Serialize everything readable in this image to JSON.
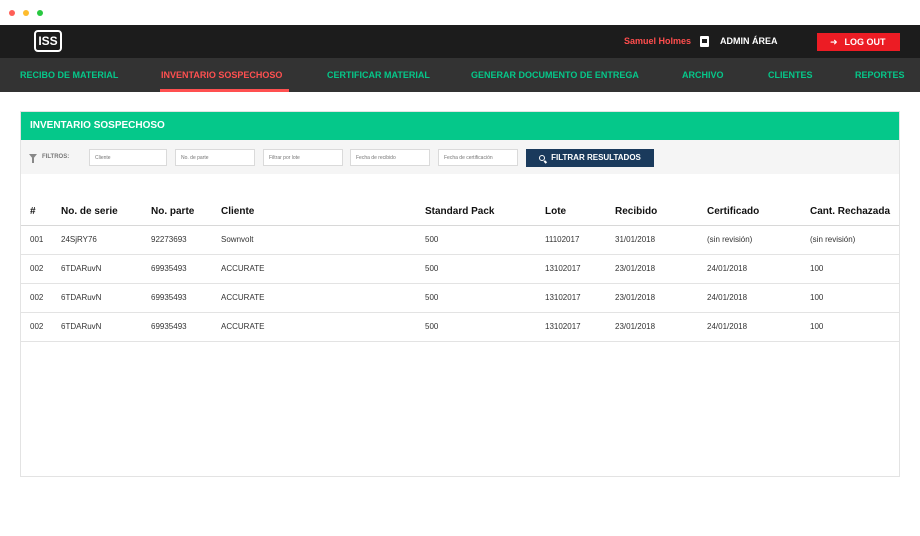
{
  "header": {
    "logo_text": "ISS",
    "user_name": "Samuel Holmes",
    "admin_label": "ADMIN ÁREA",
    "logout_label": "LOG OUT"
  },
  "nav": {
    "items": [
      {
        "label": "RECIBO DE MATERIAL",
        "active": false
      },
      {
        "label": "INVENTARIO SOSPECHOSO",
        "active": true
      },
      {
        "label": "CERTIFICAR MATERIAL",
        "active": false
      },
      {
        "label": "GENERAR  DOCUMENTO DE ENTREGA",
        "active": false
      },
      {
        "label": "ARCHIVO",
        "active": false
      },
      {
        "label": "CLIENTES",
        "active": false
      },
      {
        "label": "REPORTES",
        "active": false
      }
    ]
  },
  "panel": {
    "title": "INVENTARIO SOSPECHOSO",
    "filters": {
      "label": "FILTROS:",
      "cliente_placeholder": "Cliente",
      "parte_placeholder": "No. de parte",
      "lote_placeholder": "Filtrar por lote",
      "recibido_placeholder": "Fecha de recibido",
      "certificacion_placeholder": "Fecha de certificación",
      "button_label": "FILTRAR RESULTADOS"
    },
    "table": {
      "headers": [
        "#",
        "No. de serie",
        "No. parte",
        "Cliente",
        "Standard Pack",
        "Lote",
        "Recibido",
        "Certificado",
        "Cant. Rechazada"
      ],
      "rows": [
        [
          "001",
          "24SjRY76",
          "92273693",
          "Sownvolt",
          "500",
          "11102017",
          "31/01/2018",
          "(sin revisión)",
          "(sin revisión)"
        ],
        [
          "002",
          "6TDARuvN",
          "69935493",
          "ACCURATE",
          "500",
          "13102017",
          "23/01/2018",
          "24/01/2018",
          "100"
        ],
        [
          "002",
          "6TDARuvN",
          "69935493",
          "ACCURATE",
          "500",
          "13102017",
          "23/01/2018",
          "24/01/2018",
          "100"
        ],
        [
          "002",
          "6TDARuvN",
          "69935493",
          "ACCURATE",
          "500",
          "13102017",
          "23/01/2018",
          "24/01/2018",
          "100"
        ]
      ]
    }
  },
  "colors": {
    "accent_green": "#05c88a",
    "active_red": "#ff5050",
    "logout_red": "#ec1c24",
    "button_navy": "#1a3a5c"
  }
}
